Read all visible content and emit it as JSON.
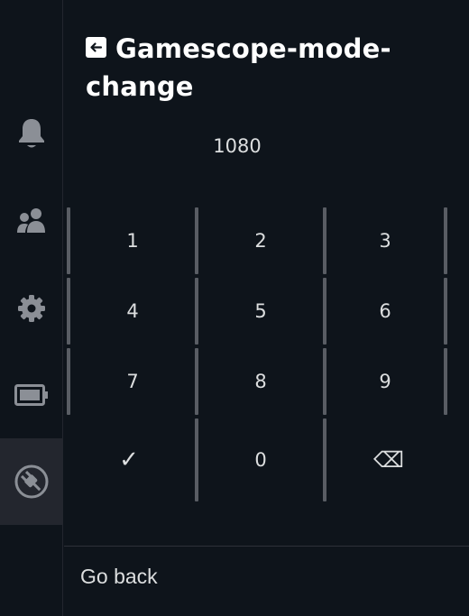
{
  "sidebar": {
    "items": [
      {
        "icon": "bell-icon"
      },
      {
        "icon": "friends-icon"
      },
      {
        "icon": "gear-icon"
      },
      {
        "icon": "battery-icon"
      },
      {
        "icon": "plug-icon",
        "active": true
      }
    ]
  },
  "header": {
    "back_icon": "arrow-left-icon",
    "title_line1": "Gamescope-mode-",
    "title_line2": "change"
  },
  "display": {
    "value": "1080"
  },
  "keypad": {
    "keys": [
      "1",
      "2",
      "3",
      "4",
      "5",
      "6",
      "7",
      "8",
      "9",
      "✓",
      "0",
      "⌫"
    ]
  },
  "footer": {
    "go_back_label": "Go back"
  },
  "colors": {
    "background": "#0e141b",
    "sidebar_active": "#23262e",
    "text": "#dcdedf",
    "title": "#ffffff",
    "divider": "#595d64"
  }
}
